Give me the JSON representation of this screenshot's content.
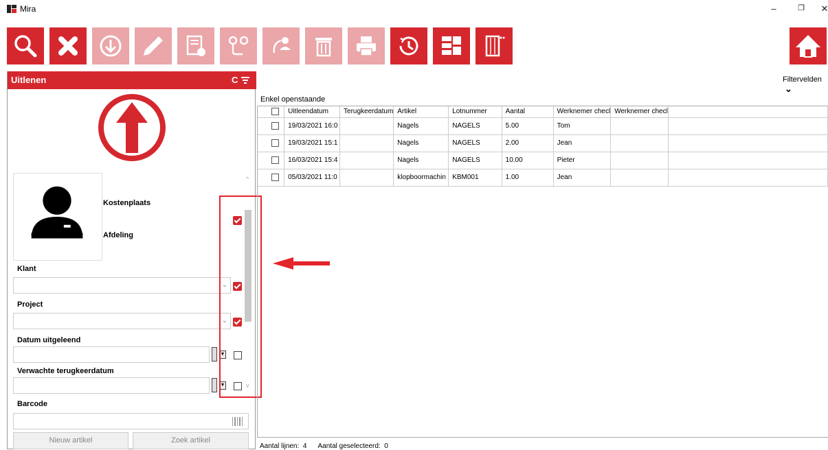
{
  "window": {
    "title": "Mira",
    "minimize": "–",
    "restore": "❐",
    "close": "✕"
  },
  "toolbar": {
    "buttons": [
      {
        "icon": "search-icon",
        "enabled": true
      },
      {
        "icon": "delete-x-icon",
        "enabled": true
      },
      {
        "icon": "download-icon",
        "enabled": false
      },
      {
        "icon": "pencil-icon",
        "enabled": false
      },
      {
        "icon": "settings-list-icon",
        "enabled": false
      },
      {
        "icon": "location-route-icon",
        "enabled": false
      },
      {
        "icon": "person-transfer-icon",
        "enabled": false
      },
      {
        "icon": "trash-icon",
        "enabled": false
      },
      {
        "icon": "printer-icon",
        "enabled": false
      },
      {
        "icon": "history-icon",
        "enabled": true
      },
      {
        "icon": "layout-grid-icon",
        "enabled": true
      },
      {
        "icon": "barcode-columns-icon",
        "enabled": true
      }
    ],
    "home_icon": "home-icon",
    "accent": "#d5282e"
  },
  "panel": {
    "title": "Uitlenen",
    "c_label": "C",
    "kostenplaats": "Kostenplaats",
    "afdeling": "Afdeling",
    "klant": "Klant",
    "project": "Project",
    "datum_uitgeleend": "Datum uitgeleend",
    "verwachte": "Verwachte terugkeerdatum",
    "barcode": "Barcode",
    "nieuw_artikel": "Nieuw artikel",
    "zoek_artikel": "Zoek artikel"
  },
  "right": {
    "filtervelden": "Filtervelden",
    "enkel": "Enkel openstaande",
    "columns": [
      "Uitleendatum",
      "Terugkeerdatum",
      "Artikel",
      "Lotnummer",
      "Aantal",
      "Werknemer checl",
      "Werknemer checl"
    ],
    "rows": [
      [
        "19/03/2021 16:0",
        "",
        "Nagels",
        "NAGELS",
        "5.00",
        "Tom",
        ""
      ],
      [
        "19/03/2021 15:1",
        "",
        "Nagels",
        "NAGELS",
        "2.00",
        "Jean",
        ""
      ],
      [
        "16/03/2021 15:4",
        "",
        "Nagels",
        "NAGELS",
        "10.00",
        "Pieter",
        ""
      ],
      [
        "05/03/2021 11:0",
        "",
        "klopboormachin",
        "KBM001",
        "1.00",
        "Jean",
        ""
      ]
    ],
    "status": "Aantal lijnen:  4      Aantal geselecteerd:  0"
  }
}
